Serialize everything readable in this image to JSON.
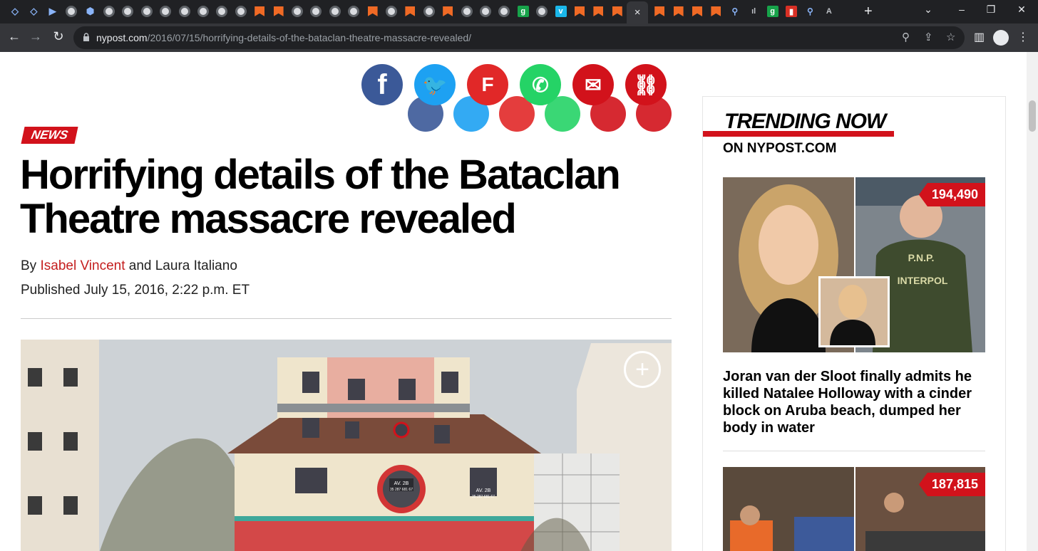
{
  "browser": {
    "url_domain": "nypost.com",
    "url_path": "/2016/07/15/horrifying-details-of-the-bataclan-theatre-massacre-revealed/",
    "tabs": [
      {
        "icon": "shield-icon",
        "fav": "shield",
        "glyph": "◇"
      },
      {
        "icon": "shield-icon",
        "fav": "shield",
        "glyph": "◇"
      },
      {
        "icon": "bookmark-icon",
        "fav": "shield",
        "glyph": "▶"
      },
      {
        "icon": "globe-icon",
        "fav": "globe",
        "glyph": ""
      },
      {
        "icon": "shield-icon",
        "fav": "shield",
        "glyph": "⬢"
      },
      {
        "icon": "globe-icon",
        "fav": "globe",
        "glyph": ""
      },
      {
        "icon": "globe-icon",
        "fav": "globe",
        "glyph": ""
      },
      {
        "icon": "globe-icon",
        "fav": "globe",
        "glyph": ""
      },
      {
        "icon": "globe-icon",
        "fav": "globe",
        "glyph": ""
      },
      {
        "icon": "globe-icon",
        "fav": "globe",
        "glyph": ""
      },
      {
        "icon": "globe-icon",
        "fav": "globe",
        "glyph": ""
      },
      {
        "icon": "globe-icon",
        "fav": "globe",
        "glyph": ""
      },
      {
        "icon": "globe-icon",
        "fav": "globe",
        "glyph": ""
      },
      {
        "icon": "nypost-icon",
        "fav": "nyp",
        "glyph": ""
      },
      {
        "icon": "nypost-icon",
        "fav": "nyp",
        "glyph": ""
      },
      {
        "icon": "globe-icon",
        "fav": "globe",
        "glyph": ""
      },
      {
        "icon": "globe-icon",
        "fav": "globe",
        "glyph": ""
      },
      {
        "icon": "globe-icon",
        "fav": "globe",
        "glyph": ""
      },
      {
        "icon": "globe-icon",
        "fav": "globe",
        "glyph": ""
      },
      {
        "icon": "nypost-icon",
        "fav": "nyp",
        "glyph": ""
      },
      {
        "icon": "globe-icon",
        "fav": "globe",
        "glyph": ""
      },
      {
        "icon": "nypost-icon",
        "fav": "nyp",
        "glyph": ""
      },
      {
        "icon": "globe-icon",
        "fav": "globe",
        "glyph": ""
      },
      {
        "icon": "nypost-icon",
        "fav": "nyp",
        "glyph": ""
      },
      {
        "icon": "globe-icon",
        "fav": "globe",
        "glyph": ""
      },
      {
        "icon": "globe-icon",
        "fav": "globe",
        "glyph": ""
      },
      {
        "icon": "globe-icon",
        "fav": "globe",
        "glyph": ""
      },
      {
        "icon": "grammarly-icon",
        "fav": "green",
        "glyph": "g"
      },
      {
        "icon": "globe-icon",
        "fav": "globe",
        "glyph": ""
      },
      {
        "icon": "vimeo-icon",
        "fav": "vimeo",
        "glyph": "v"
      },
      {
        "icon": "nypost-icon",
        "fav": "nyp",
        "glyph": ""
      },
      {
        "icon": "nypost-icon",
        "fav": "nyp",
        "glyph": ""
      },
      {
        "icon": "nypost-icon",
        "fav": "nyp",
        "glyph": ""
      },
      {
        "icon": "nypost-icon",
        "fav": "nyp",
        "glyph": ""
      },
      {
        "icon": "nypost-icon",
        "fav": "nyp",
        "glyph": ""
      },
      {
        "icon": "nypost-icon",
        "fav": "nyp",
        "glyph": ""
      },
      {
        "icon": "nypost-icon",
        "fav": "nyp",
        "glyph": ""
      },
      {
        "icon": "search-icon",
        "fav": "srch",
        "glyph": "⚲"
      },
      {
        "icon": "cc-icon",
        "fav": "cc",
        "glyph": "ıl"
      },
      {
        "icon": "grammarly-icon",
        "fav": "green",
        "glyph": "g"
      },
      {
        "icon": "mic-icon",
        "fav": "red",
        "glyph": "▮"
      },
      {
        "icon": "search-icon",
        "fav": "srch",
        "glyph": "⚲"
      },
      {
        "icon": "font-icon",
        "fav": "cc",
        "glyph": "A"
      }
    ],
    "active_tab_close": "×",
    "new_tab": "+",
    "window_controls": [
      "⌄",
      "–",
      "❐",
      "✕"
    ]
  },
  "article": {
    "category": "NEWS",
    "headline": "Horrifying details of the Bataclan Theatre massacre revealed",
    "byline_prefix": "By",
    "author1": "Isabel Vincent",
    "byline_and": "and Laura Italiano",
    "published": "Published July 15, 2016, 2:22 p.m. ET",
    "photo_signs": [
      "AV. 2B",
      "AV. 2B"
    ],
    "photo_sign_sub": [
      "35 287 681 67",
      "35 287 681 67"
    ]
  },
  "share": [
    {
      "name": "facebook",
      "icon": "facebook-icon",
      "color": "#3b5998",
      "glyph": "f"
    },
    {
      "name": "twitter",
      "icon": "twitter-icon",
      "color": "#1da1f2",
      "glyph": "🐦"
    },
    {
      "name": "flipboard",
      "icon": "flipboard-icon",
      "color": "#e12828",
      "glyph": "F"
    },
    {
      "name": "whatsapp",
      "icon": "whatsapp-icon",
      "color": "#25d366",
      "glyph": "✆"
    },
    {
      "name": "email",
      "icon": "email-icon",
      "color": "#d2121b",
      "glyph": "✉"
    },
    {
      "name": "copy-link",
      "icon": "link-icon",
      "color": "#d2121b",
      "glyph": "⛓"
    }
  ],
  "sidebar": {
    "title": "TRENDING NOW",
    "subtitle": "ON NYPOST.COM",
    "items": [
      {
        "views": "194,490",
        "title": "Joran van der Sloot finally admits he killed Natalee Holloway with a cinder block on Aruba beach, dumped her body in water",
        "vest_text": "P.N.P.",
        "vest_text2": "INTERPOL"
      },
      {
        "views": "187,815",
        "title": ""
      }
    ]
  },
  "colors": {
    "brand_red": "#d2121b",
    "link_red": "#c41e1e"
  }
}
